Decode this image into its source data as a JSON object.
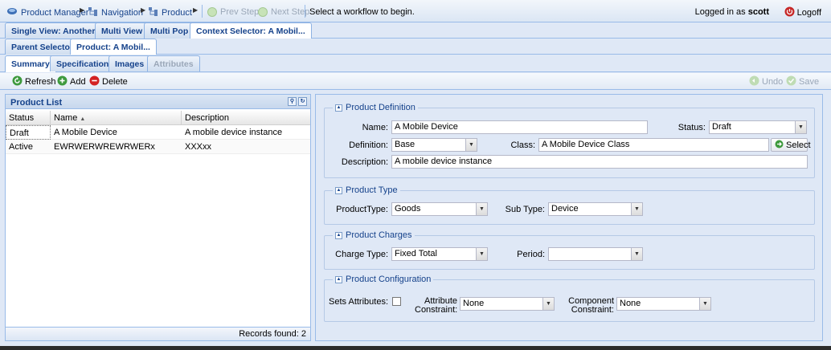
{
  "topbar": {
    "product_manager": "Product Manager",
    "navigation": "Navigation",
    "product": "Product",
    "prev_step": "Prev Step",
    "next_step": "Next Step",
    "message": "Select a workflow to begin.",
    "logged_in_prefix": "Logged in as",
    "username": "scott",
    "logoff": "Logoff"
  },
  "tabs_row1": [
    "Single View: Another...",
    "Multi View",
    "Multi Pop",
    "Context Selector: A Mobil..."
  ],
  "tabs_row2": [
    "Parent Selector",
    "Product: A Mobil..."
  ],
  "tabs_row3": [
    "Summary",
    "Specification",
    "Images",
    "Attributes"
  ],
  "toolbar": {
    "refresh": "Refresh",
    "add": "Add",
    "delete": "Delete",
    "undo": "Undo",
    "save": "Save"
  },
  "product_list": {
    "title": "Product List",
    "columns": [
      "Status",
      "Name",
      "Description"
    ],
    "rows": [
      {
        "status": "Draft",
        "name": "A Mobile Device",
        "description": "A mobile device instance"
      },
      {
        "status": "Active",
        "name": "EWRWERWREWRWERx",
        "description": "XXXxx"
      }
    ],
    "records_found": "Records found: 2"
  },
  "definition": {
    "legend": "Product Definition",
    "name_label": "Name:",
    "name_value": "A Mobile Device",
    "status_label": "Status:",
    "status_value": "Draft",
    "definition_label": "Definition:",
    "definition_value": "Base",
    "class_label": "Class:",
    "class_value": "A Mobile Device Class",
    "select_button": "Select",
    "description_label": "Description:",
    "description_value": "A mobile device instance"
  },
  "type": {
    "legend": "Product Type",
    "product_type_label": "ProductType:",
    "product_type_value": "Goods",
    "sub_type_label": "Sub Type:",
    "sub_type_value": "Device"
  },
  "charges": {
    "legend": "Product Charges",
    "charge_type_label": "Charge Type:",
    "charge_type_value": "Fixed Total",
    "period_label": "Period:",
    "period_value": ""
  },
  "configuration": {
    "legend": "Product Configuration",
    "sets_attributes_label": "Sets Attributes:",
    "attribute_constraint_label_1": "Attribute",
    "attribute_constraint_label_2": "Constraint:",
    "attribute_constraint_value": "None",
    "component_constraint_label_1": "Component",
    "component_constraint_label_2": "Constraint:",
    "component_constraint_value": "None"
  },
  "colors": {
    "accent": "#15428b",
    "border": "#99bbe8",
    "background": "#dfe8f6"
  }
}
